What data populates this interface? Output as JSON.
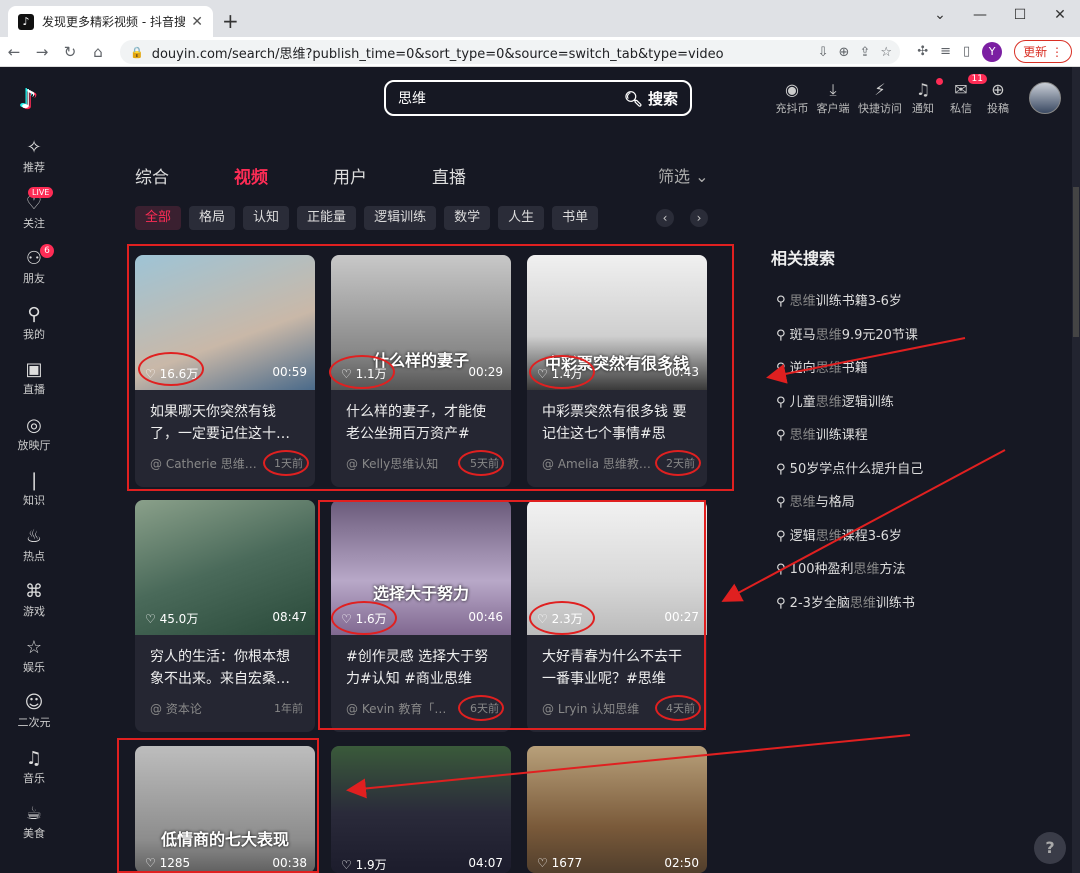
{
  "browser": {
    "tab_title": "发现更多精彩视频 - 抖音搜索",
    "url": "douyin.com/search/思维?publish_time=0&sort_type=0&source=switch_tab&type=video",
    "profile_letter": "Y",
    "update_label": "更新"
  },
  "sidebar": {
    "items": [
      {
        "label": "推荐",
        "icon": "✧"
      },
      {
        "label": "关注",
        "icon": "♡",
        "badge": "LIVE"
      },
      {
        "label": "朋友",
        "icon": "⚇",
        "badge": "6"
      },
      {
        "label": "我的",
        "icon": "⚲"
      },
      {
        "label": "直播",
        "icon": "▣"
      },
      {
        "label": "放映厅",
        "icon": "◎"
      },
      {
        "label": "知识",
        "icon": "❘"
      },
      {
        "label": "热点",
        "icon": "♨"
      },
      {
        "label": "游戏",
        "icon": "⌘"
      },
      {
        "label": "娱乐",
        "icon": "☆"
      },
      {
        "label": "二次元",
        "icon": "☺"
      },
      {
        "label": "音乐",
        "icon": "♫"
      },
      {
        "label": "美食",
        "icon": "☕"
      }
    ]
  },
  "header": {
    "search_query": "思维",
    "search_button": "搜索",
    "icons": [
      {
        "label": "充抖币",
        "icon": "◉"
      },
      {
        "label": "客户端",
        "icon": "⤓"
      },
      {
        "label": "快捷访问",
        "icon": "⚡"
      },
      {
        "label": "通知",
        "icon": "♫"
      },
      {
        "label": "私信",
        "icon": "✉",
        "badge": "11"
      },
      {
        "label": "投稿",
        "icon": "⊕"
      }
    ]
  },
  "main_tabs": [
    "综合",
    "视频",
    "用户",
    "直播"
  ],
  "filter_label": "筛选",
  "chips": [
    "全部",
    "格局",
    "认知",
    "正能量",
    "逻辑训练",
    "数学",
    "人生",
    "书单"
  ],
  "videos": [
    {
      "likes": "16.6万",
      "duration": "00:59",
      "title": "如果哪天你突然有钱了，一定要记住这十…",
      "author": "@ Catherie 思维…",
      "date": "1天前",
      "overlay": ""
    },
    {
      "likes": "1.1万",
      "duration": "00:29",
      "title": "什么样的妻子，才能使老公坐拥百万资产#人…",
      "author": "@ Kelly思维认知",
      "date": "5天前",
      "overlay": "什么样的妻子"
    },
    {
      "likes": "1.4万",
      "duration": "00:43",
      "title": "中彩票突然有很多钱 要记住这七个事情#思维…",
      "author": "@ Amelia 思维教…",
      "date": "2天前",
      "overlay": "中彩票突然有很多钱"
    },
    {
      "likes": "45.0万",
      "duration": "08:47",
      "title": "穷人的生活：你根本想象不出来。来自宏桑…",
      "author": "@ 资本论",
      "date": "1年前",
      "overlay": ""
    },
    {
      "likes": "1.6万",
      "duration": "00:46",
      "title": "#创作灵感 选择大于努力#认知 #商业思维 #…",
      "author": "@ Kevin 教育「…",
      "date": "6天前",
      "overlay": "选择大于努力"
    },
    {
      "likes": "2.3万",
      "duration": "00:27",
      "title": "大好青春为什么不去干一番事业呢？#思维认…",
      "author": "@ Lryin 认知思维",
      "date": "4天前",
      "overlay": ""
    },
    {
      "likes": "1285",
      "duration": "00:38",
      "title": "",
      "author": "",
      "date": "",
      "overlay": "低情商的七大表现"
    },
    {
      "likes": "1.9万",
      "duration": "04:07",
      "title": "",
      "author": "",
      "date": "",
      "overlay": ""
    },
    {
      "likes": "1677",
      "duration": "02:50",
      "title": "",
      "author": "",
      "date": "",
      "overlay": ""
    }
  ],
  "related": {
    "title": "相关搜索",
    "items": [
      {
        "hl": "思维",
        "rest": "训练书籍3-6岁",
        "prefix": ""
      },
      {
        "prefix": "斑马",
        "hl": "思维",
        "rest": "9.9元20节课"
      },
      {
        "prefix": "逆向",
        "hl": "思维",
        "rest": "书籍"
      },
      {
        "prefix": "儿童",
        "hl": "思维",
        "rest": "逻辑训练"
      },
      {
        "prefix": "",
        "hl": "思维",
        "rest": "训练课程"
      },
      {
        "prefix": "50岁学点什么提升自己",
        "hl": "",
        "rest": ""
      },
      {
        "prefix": "",
        "hl": "思维",
        "rest": "与格局"
      },
      {
        "prefix": "逻辑",
        "hl": "思维",
        "rest": "课程3-6岁"
      },
      {
        "prefix": "100种盈利",
        "hl": "思维",
        "rest": "方法"
      },
      {
        "prefix": "2-3岁全脑",
        "hl": "思维",
        "rest": "训练书"
      }
    ]
  },
  "colors": {
    "accent": "#fe2c55",
    "background": "#161823",
    "card": "#252632",
    "annotation": "#e02020"
  }
}
